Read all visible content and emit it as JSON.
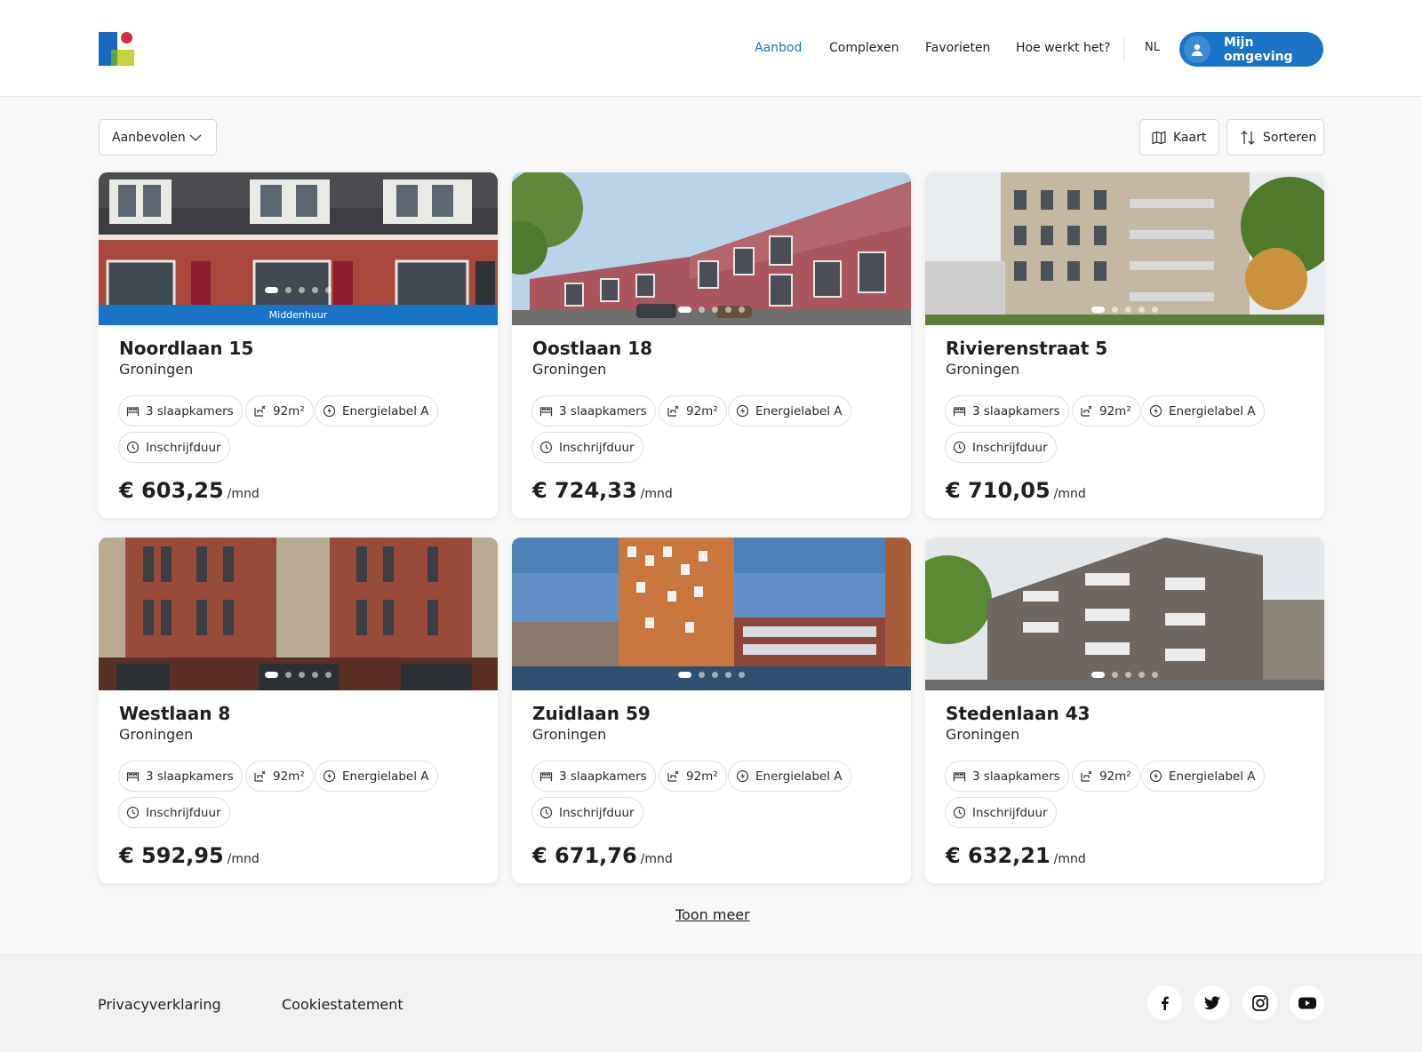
{
  "header": {
    "nav": [
      "Aanbod",
      "Complexen",
      "Favorieten",
      "Hoe werkt het?"
    ],
    "active_nav": "Aanbod",
    "language": "NL",
    "account_label": "Mijn omgeving"
  },
  "toolbar": {
    "filter_value": "Aanbevolen",
    "map_label": "Kaart",
    "sort_label": "Sorteren"
  },
  "listings": [
    {
      "title": "Noordlaan 15",
      "city": "Groningen",
      "bedrooms": "3 slaapkamers",
      "area": "92m²",
      "energy": "Energielabel A",
      "condition": "Inschrijfduur",
      "price": "€ 603,25",
      "unit": "/mnd",
      "badge": "Middenhuur",
      "photo": "row-houses"
    },
    {
      "title": "Oostlaan 18",
      "city": "Groningen",
      "bedrooms": "3 slaapkamers",
      "area": "92m²",
      "energy": "Energielabel A",
      "condition": "Inschrijfduur",
      "price": "€ 724,33",
      "unit": "/mnd",
      "photo": "brick-apartments"
    },
    {
      "title": "Rivierenstraat 5",
      "city": "Groningen",
      "bedrooms": "3 slaapkamers",
      "area": "92m²",
      "energy": "Energielabel A",
      "condition": "Inschrijfduur",
      "price": "€ 710,05",
      "unit": "/mnd",
      "photo": "beige-flat"
    },
    {
      "title": "Westlaan 8",
      "city": "Groningen",
      "bedrooms": "3 slaapkamers",
      "area": "92m²",
      "energy": "Energielabel A",
      "condition": "Inschrijfduur",
      "price": "€ 592,95",
      "unit": "/mnd",
      "photo": "brick-block"
    },
    {
      "title": "Zuidlaan 59",
      "city": "Groningen",
      "bedrooms": "3 slaapkamers",
      "area": "92m²",
      "energy": "Energielabel A",
      "condition": "Inschrijfduur",
      "price": "€ 671,76",
      "unit": "/mnd",
      "photo": "waterfront"
    },
    {
      "title": "Stedenlaan 43",
      "city": "Groningen",
      "bedrooms": "3 slaapkamers",
      "area": "92m²",
      "energy": "Energielabel A",
      "condition": "Inschrijfduur",
      "price": "€ 632,21",
      "unit": "/mnd",
      "photo": "grey-apartments"
    }
  ],
  "more_label": "Toon meer",
  "footer": {
    "links": [
      "Privacyverklaring",
      "Cookiestatement"
    ],
    "social_icons": [
      "facebook-icon",
      "twitter-icon",
      "instagram-icon",
      "youtube-icon"
    ]
  },
  "colors": {
    "accent": "#1a73c4",
    "background": "#f8f8f8"
  }
}
